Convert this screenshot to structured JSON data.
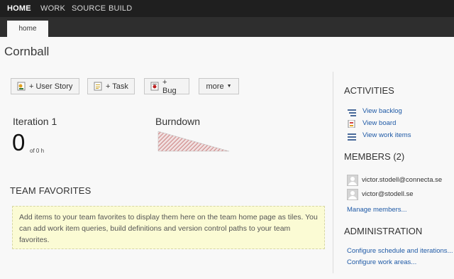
{
  "topnav": {
    "items": [
      {
        "label": "HOME",
        "active": true
      },
      {
        "label": "WORK",
        "active": false
      },
      {
        "label": "SOURCE",
        "active": false
      },
      {
        "label": "BUILD",
        "active": false
      }
    ]
  },
  "subnav": {
    "tab": "home"
  },
  "project": {
    "title": "Cornball"
  },
  "toolbar": {
    "user_story": "+ User Story",
    "task": "+ Task",
    "bug": "+ Bug",
    "more": "more"
  },
  "iteration": {
    "title": "Iteration 1",
    "remaining": "0",
    "of": "of 0 h"
  },
  "burndown": {
    "title": "Burndown"
  },
  "favorites": {
    "title": "TEAM FAVORITES",
    "message": "Add items to your team favorites to display them here on the team home page as tiles. You can add work item queries, build definitions and version control paths to your team favorites."
  },
  "activities": {
    "title": "ACTIVITIES",
    "links": [
      {
        "label": "View backlog",
        "icon": "backlog-icon"
      },
      {
        "label": "View board",
        "icon": "board-icon"
      },
      {
        "label": "View work items",
        "icon": "work-items-icon"
      }
    ]
  },
  "members": {
    "title": "MEMBERS (2)",
    "list": [
      "victor.stodell@connecta.se",
      "victor@stodell.se"
    ],
    "manage": "Manage members..."
  },
  "administration": {
    "title": "ADMINISTRATION",
    "links": [
      "Configure schedule and iterations...",
      "Configure work areas..."
    ]
  },
  "colors": {
    "topbar": "#1f1f1f",
    "subbar": "#2e2e2e",
    "link": "#1f5aa6",
    "favorites_bg": "#fbfbd4"
  }
}
